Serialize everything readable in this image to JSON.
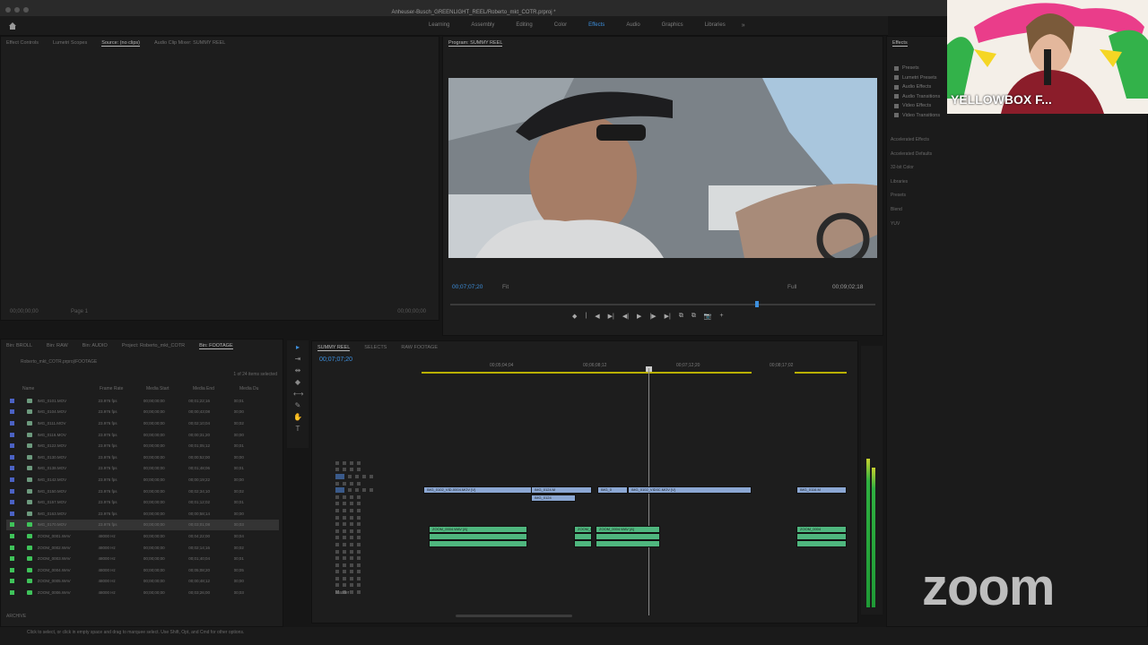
{
  "window": {
    "title": "Anheuser-Busch_GREENLIGHT_REEL/Roberto_mkt_COTR.prproj *"
  },
  "workspaces": {
    "tabs": [
      "Learning",
      "Assembly",
      "Editing",
      "Color",
      "Effects",
      "Audio",
      "Graphics",
      "Libraries"
    ],
    "active": "Effects",
    "more": "»"
  },
  "source_panel": {
    "tabs": [
      "Effect Controls",
      "Lumetri Scopes",
      "Source: (no clips)",
      "Audio Clip Mixer: SUMMY REEL"
    ],
    "timecode_left": "00;00;00;00",
    "timecode_right": "00;00;00;00",
    "zoom": "Page 1"
  },
  "program_panel": {
    "tab": "Program: SUMMY REEL",
    "timecode": "00;07;07;20",
    "fit": "Fit",
    "quality": "Full",
    "duration": "00;09;02;18",
    "transport": [
      "◆",
      "|",
      "◀",
      "▶|",
      "◀|",
      "▶",
      "|▶",
      "▶|",
      "⧉",
      "⧉",
      "📷",
      "+"
    ]
  },
  "effects_panel": {
    "title": "Effects",
    "tree": [
      "Presets",
      "Lumetri Presets",
      "Audio Effects",
      "Audio Transitions",
      "Video Effects",
      "Video Transitions"
    ],
    "labels": [
      "Accelerated Effects",
      "Accelerated Defaults",
      "32-bit Color",
      "Libraries",
      "Presets",
      "Blend",
      "YUV"
    ]
  },
  "project_panel": {
    "tabs": [
      "Bin: BROLL",
      "Bin: RAW",
      "Bin: AUDIO",
      "Project: Roberto_mkt_COTR",
      "Bin: FOOTAGE"
    ],
    "path": "Roberto_mkt_COTR.prproj\\FOOTAGE",
    "count": "1 of 24 items selected",
    "columns": [
      "Name",
      "Frame Rate",
      "Media Start",
      "Media End",
      "Media Du"
    ],
    "rows": [
      {
        "name": "IMG_0101.MOV",
        "fps": "23.976 fps",
        "start": "00;00;00;00",
        "end": "00;01;22;16",
        "dur": "00;01",
        "color": "#4b62c4",
        "sel": false
      },
      {
        "name": "IMG_0104.MOV",
        "fps": "23.976 fps",
        "start": "00;00;00;00",
        "end": "00;00;43;08",
        "dur": "00;00",
        "color": "#4b62c4",
        "sel": false
      },
      {
        "name": "IMG_0111.MOV",
        "fps": "23.976 fps",
        "start": "00;00;00;00",
        "end": "00;02;10;04",
        "dur": "00;02",
        "color": "#4b62c4",
        "sel": false
      },
      {
        "name": "IMG_0116.MOV",
        "fps": "23.976 fps",
        "start": "00;00;00;00",
        "end": "00;00;31;20",
        "dur": "00;00",
        "color": "#4b62c4",
        "sel": false
      },
      {
        "name": "IMG_0122.MOV",
        "fps": "23.976 fps",
        "start": "00;00;00;00",
        "end": "00;01;05;12",
        "dur": "00;01",
        "color": "#4b62c4",
        "sel": false
      },
      {
        "name": "IMG_0130.MOV",
        "fps": "23.976 fps",
        "start": "00;00;00;00",
        "end": "00;00;52;00",
        "dur": "00;00",
        "color": "#4b62c4",
        "sel": false
      },
      {
        "name": "IMG_0138.MOV",
        "fps": "23.976 fps",
        "start": "00;00;00;00",
        "end": "00;01;48;06",
        "dur": "00;01",
        "color": "#4b62c4",
        "sel": false
      },
      {
        "name": "IMG_0142.MOV",
        "fps": "23.976 fps",
        "start": "00;00;00;00",
        "end": "00;00;19;22",
        "dur": "00;00",
        "color": "#4b62c4",
        "sel": false
      },
      {
        "name": "IMG_0150.MOV",
        "fps": "23.976 fps",
        "start": "00;00;00;00",
        "end": "00;02;34;10",
        "dur": "00;02",
        "color": "#4b62c4",
        "sel": false
      },
      {
        "name": "IMG_0157.MOV",
        "fps": "23.976 fps",
        "start": "00;00;00;00",
        "end": "00;01;12;02",
        "dur": "00;01",
        "color": "#4b62c4",
        "sel": false
      },
      {
        "name": "IMG_0163.MOV",
        "fps": "23.976 fps",
        "start": "00;00;00;00",
        "end": "00;00;58;14",
        "dur": "00;00",
        "color": "#4b62c4",
        "sel": false
      },
      {
        "name": "IMG_0170.MOV",
        "fps": "23.976 fps",
        "start": "00;00;00;00",
        "end": "00;03;01;08",
        "dur": "00;03",
        "color": "#3fc35a",
        "sel": true
      },
      {
        "name": "ZOOM_0001.WAV",
        "fps": "48000 Hz",
        "start": "00;00;00;00",
        "end": "00;04;22;00",
        "dur": "00;04",
        "color": "#3fc35a",
        "sel": false
      },
      {
        "name": "ZOOM_0002.WAV",
        "fps": "48000 Hz",
        "start": "00;00;00;00",
        "end": "00;02;14;16",
        "dur": "00;02",
        "color": "#3fc35a",
        "sel": false
      },
      {
        "name": "ZOOM_0003.WAV",
        "fps": "48000 Hz",
        "start": "00;00;00;00",
        "end": "00;01;40;04",
        "dur": "00;01",
        "color": "#3fc35a",
        "sel": false
      },
      {
        "name": "ZOOM_0004.WAV",
        "fps": "48000 Hz",
        "start": "00;00;00;00",
        "end": "00;05;08;20",
        "dur": "00;05",
        "color": "#3fc35a",
        "sel": false
      },
      {
        "name": "ZOOM_0005.WAV",
        "fps": "48000 Hz",
        "start": "00;00;00;00",
        "end": "00;00;48;12",
        "dur": "00;00",
        "color": "#3fc35a",
        "sel": false
      },
      {
        "name": "ZOOM_0006.WAV",
        "fps": "48000 Hz",
        "start": "00;00;00;00",
        "end": "00;03;26;00",
        "dur": "00;03",
        "color": "#3fc35a",
        "sel": false
      }
    ],
    "folder": "ARCHIVE"
  },
  "timeline": {
    "tabs": [
      "SUMMY REEL",
      "SELECTS",
      "RAW FOOTAGE"
    ],
    "timecode": "00;07;07;20",
    "ruler": [
      "00;05;04;04",
      "00;06;08;12",
      "00;07;12;20",
      "00;08;17;02"
    ],
    "video_clips": [
      {
        "label": "IMG_0102_VID-0004.MOV [V]",
        "track": 0
      },
      {
        "label": "IMG_0124.M",
        "track": 0
      },
      {
        "label": "IMG_0",
        "track": 0
      },
      {
        "label": "IMG_0102_VID0C.MOV [V]",
        "track": 0
      },
      {
        "label": "IMG_0116.M",
        "track": 0
      },
      {
        "label": "IMG_0124",
        "track": 1
      }
    ],
    "audio_clips": [
      {
        "label": "ZOOM_0004.WAV [A]",
        "track": 0
      },
      {
        "label": "ZOOM_0004.WAV [A]",
        "track": 0
      },
      {
        "label": "ZOOM_0004.WAV [A]",
        "track": 0
      },
      {
        "label": "ZOOM_0004",
        "track": 0
      }
    ],
    "master": "Master"
  },
  "meters": {
    "left": 0.72,
    "right": 0.68
  },
  "zoom": {
    "logo": "zoom",
    "participant": "YELLOWBOX F..."
  },
  "statusbar": {
    "text": "Click to select, or click in empty space and drag to marquee select. Use Shift, Opt, and Cmd for other options."
  },
  "colors": {
    "accent": "#3d8fdd",
    "video_clip": "#8ba7d3",
    "audio_clip": "#4fb67e",
    "work_area": "#b9b000"
  }
}
